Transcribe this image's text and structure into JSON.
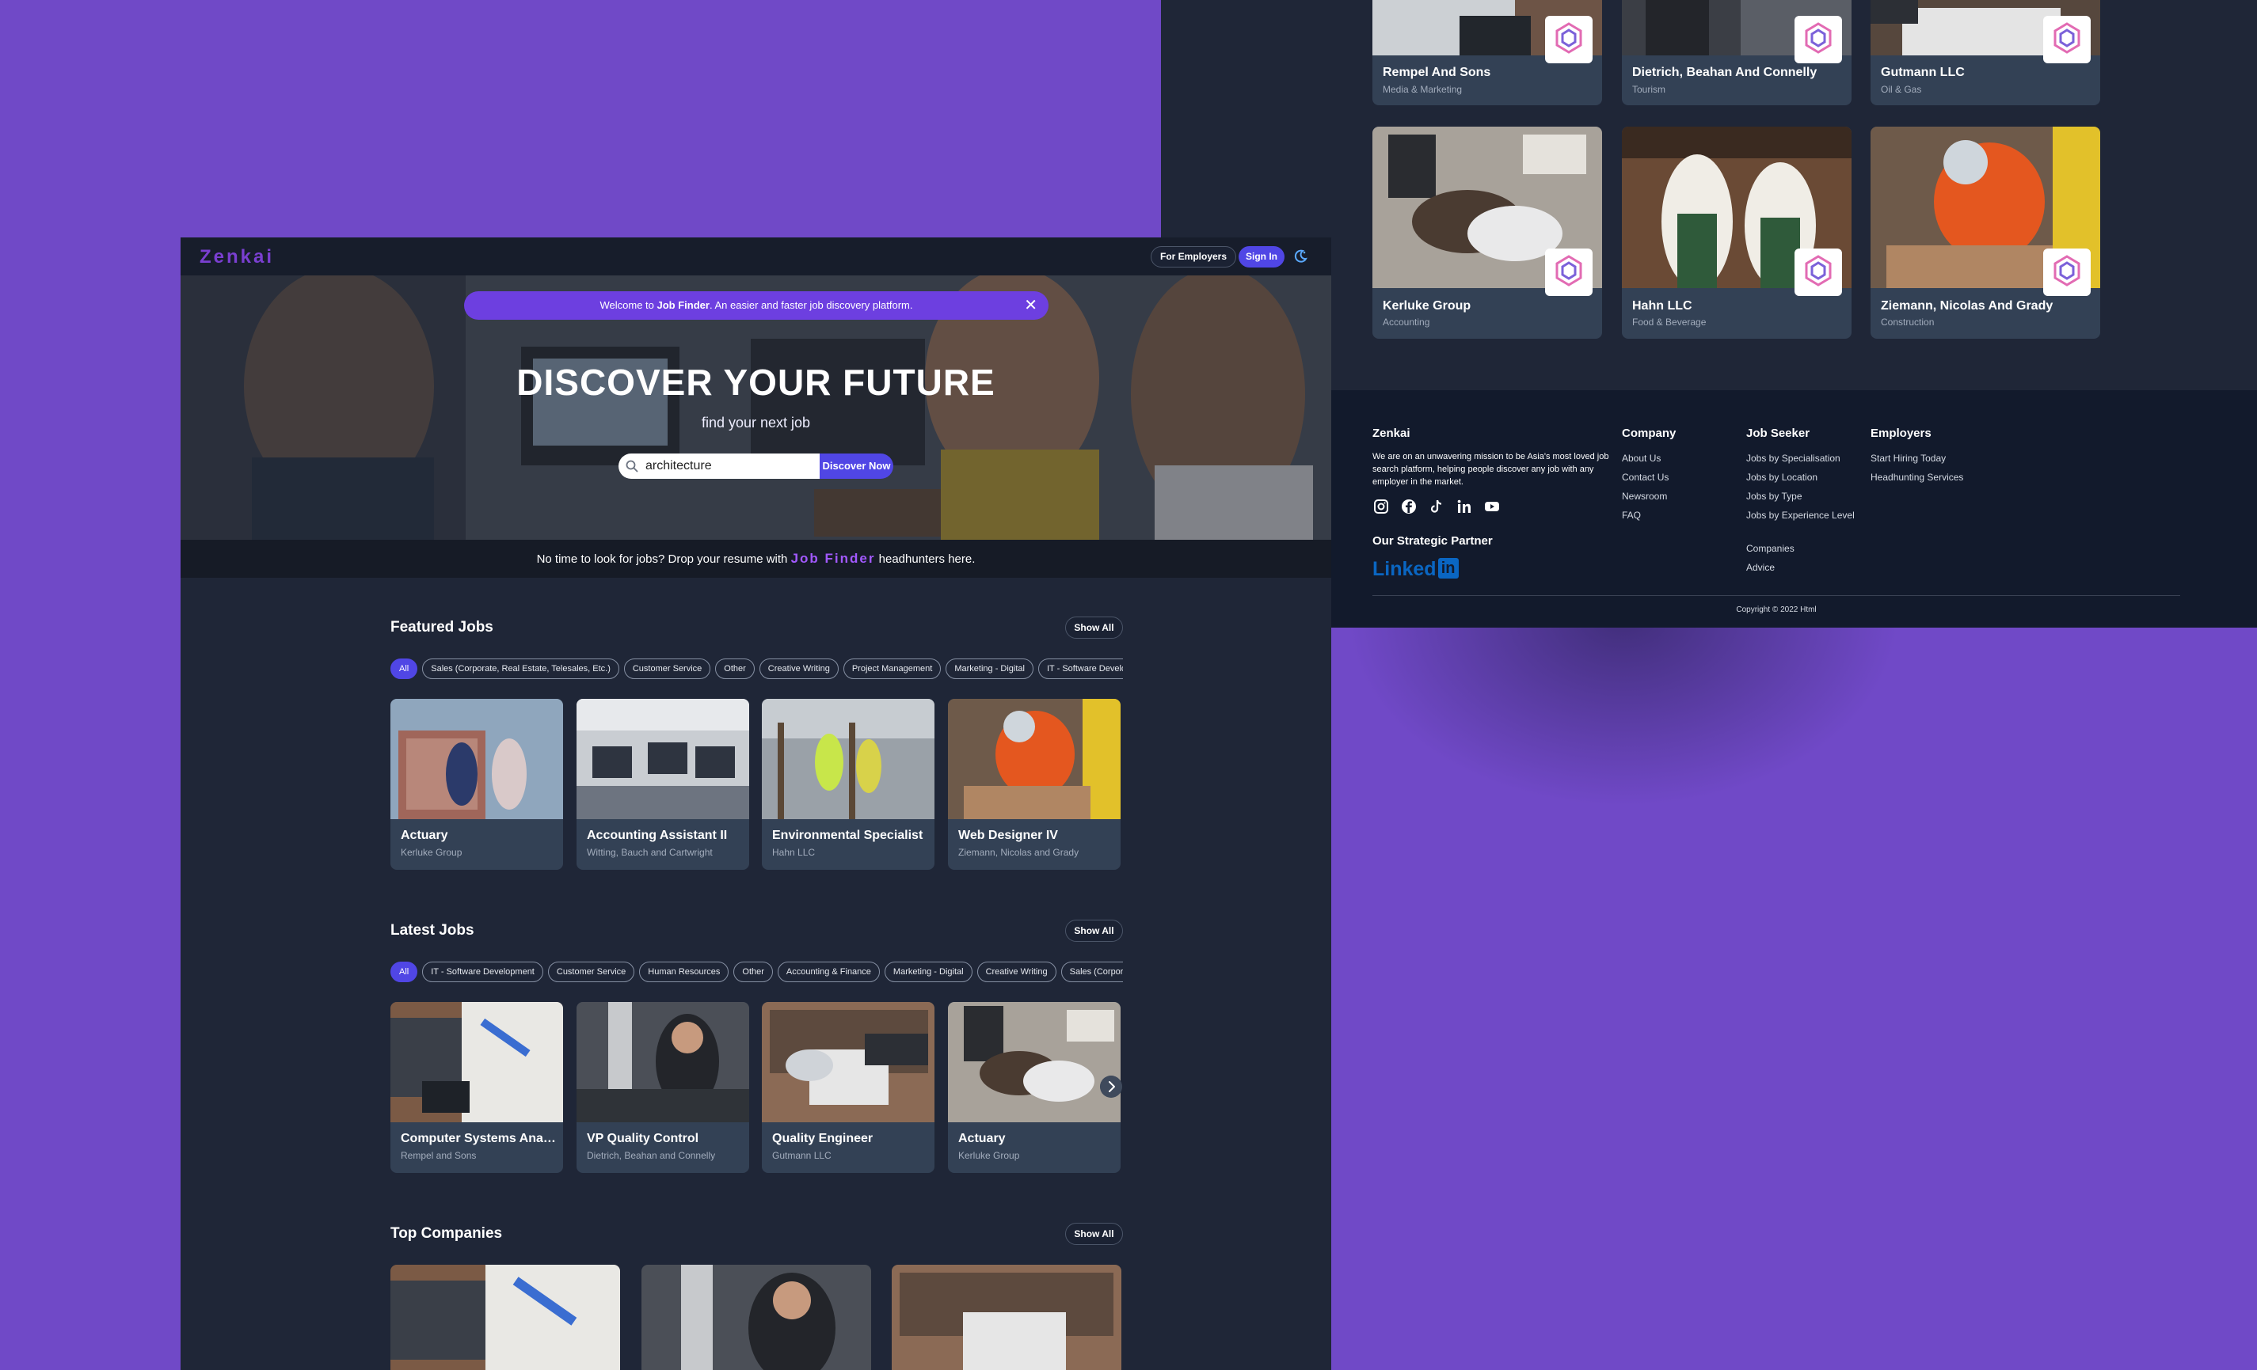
{
  "app": {
    "logo": "Zenkai"
  },
  "nav": {
    "for_employers": "For Employers",
    "sign_in": "Sign In",
    "theme_icon": "theme-toggle-icon"
  },
  "hero": {
    "banner_prefix": "Welcome to ",
    "banner_brand": "Job Finder",
    "banner_suffix": ". An easier and faster job discovery platform.",
    "title": "DISCOVER YOUR FUTURE",
    "subtitle": "find your next job",
    "search_value": "architecture",
    "search_button": "Discover Now"
  },
  "resume_bar": {
    "prefix": "No time to look for jobs? Drop your resume with ",
    "brand": "Job Finder",
    "suffix": " headhunters here."
  },
  "featured": {
    "title": "Featured Jobs",
    "show_all": "Show All",
    "chips": [
      "All",
      "Sales (Corporate, Real Estate, Telesales, Etc.)",
      "Customer Service",
      "Other",
      "Creative Writing",
      "Project Management",
      "Marketing - Digital",
      "IT - Software Development"
    ],
    "jobs": [
      {
        "title": "Actuary",
        "company": "Kerluke Group"
      },
      {
        "title": "Accounting Assistant II",
        "company": "Witting, Bauch and Cartwright"
      },
      {
        "title": "Environmental Specialist",
        "company": "Hahn LLC"
      },
      {
        "title": "Web Designer IV",
        "company": "Ziemann, Nicolas and Grady"
      }
    ]
  },
  "latest": {
    "title": "Latest Jobs",
    "show_all": "Show All",
    "chips": [
      "All",
      "IT - Software Development",
      "Customer Service",
      "Human Resources",
      "Other",
      "Accounting & Finance",
      "Marketing - Digital",
      "Creative Writing",
      "Sales (Corporate, Real Estate, Telesales, Etc.)"
    ],
    "jobs": [
      {
        "title": "Computer Systems Analyst",
        "company": "Rempel and Sons"
      },
      {
        "title": "VP Quality Control",
        "company": "Dietrich, Beahan and Connelly"
      },
      {
        "title": "Quality Engineer",
        "company": "Gutmann LLC"
      },
      {
        "title": "Actuary",
        "company": "Kerluke Group"
      }
    ]
  },
  "top_companies": {
    "title": "Top Companies",
    "show_all": "Show All"
  },
  "companies": [
    {
      "name": "Rempel And Sons",
      "industry": "Media & Marketing",
      "badge": "MiddV"
    },
    {
      "name": "Dietrich, Beahan And Connelly",
      "industry": "Tourism",
      "badge": "MiddV"
    },
    {
      "name": "Gutmann LLC",
      "industry": "Oil & Gas",
      "badge": "MiddV"
    },
    {
      "name": "Kerluke Group",
      "industry": "Accounting",
      "badge": "MiddV"
    },
    {
      "name": "Hahn LLC",
      "industry": "Food & Beverage",
      "badge": "MiddV"
    },
    {
      "name": "Ziemann, Nicolas And Grady",
      "industry": "Construction",
      "badge": "MiddV"
    }
  ],
  "footer": {
    "brand": "Zenkai",
    "mission": "We are on an unwavering mission to be Asia's most loved job search platform, helping people discover any job with any employer in the market.",
    "socials": [
      "instagram-icon",
      "facebook-icon",
      "tiktok-icon",
      "linkedin-icon",
      "youtube-icon"
    ],
    "partner_title": "Our Strategic Partner",
    "partner_name": "Linked",
    "partner_in": "in",
    "company": {
      "title": "Company",
      "links": [
        "About Us",
        "Contact Us",
        "Newsroom",
        "FAQ"
      ]
    },
    "job_seeker": {
      "title": "Job Seeker",
      "links": [
        "Jobs by Specialisation",
        "Jobs by Location",
        "Jobs by Type",
        "Jobs by Experience Level",
        "Companies",
        "Advice"
      ]
    },
    "employers": {
      "title": "Employers",
      "links": [
        "Start Hiring Today",
        "Headhunting Services"
      ]
    },
    "copyright": "Copyright © 2022 Html"
  },
  "colors": {
    "page_bg": "#7049c7",
    "accent": "#5046e5",
    "brand_purple": "#7a3fd1",
    "card_bg": "#334155",
    "surface": "#1f2637",
    "footer_bg": "#121a2c"
  }
}
